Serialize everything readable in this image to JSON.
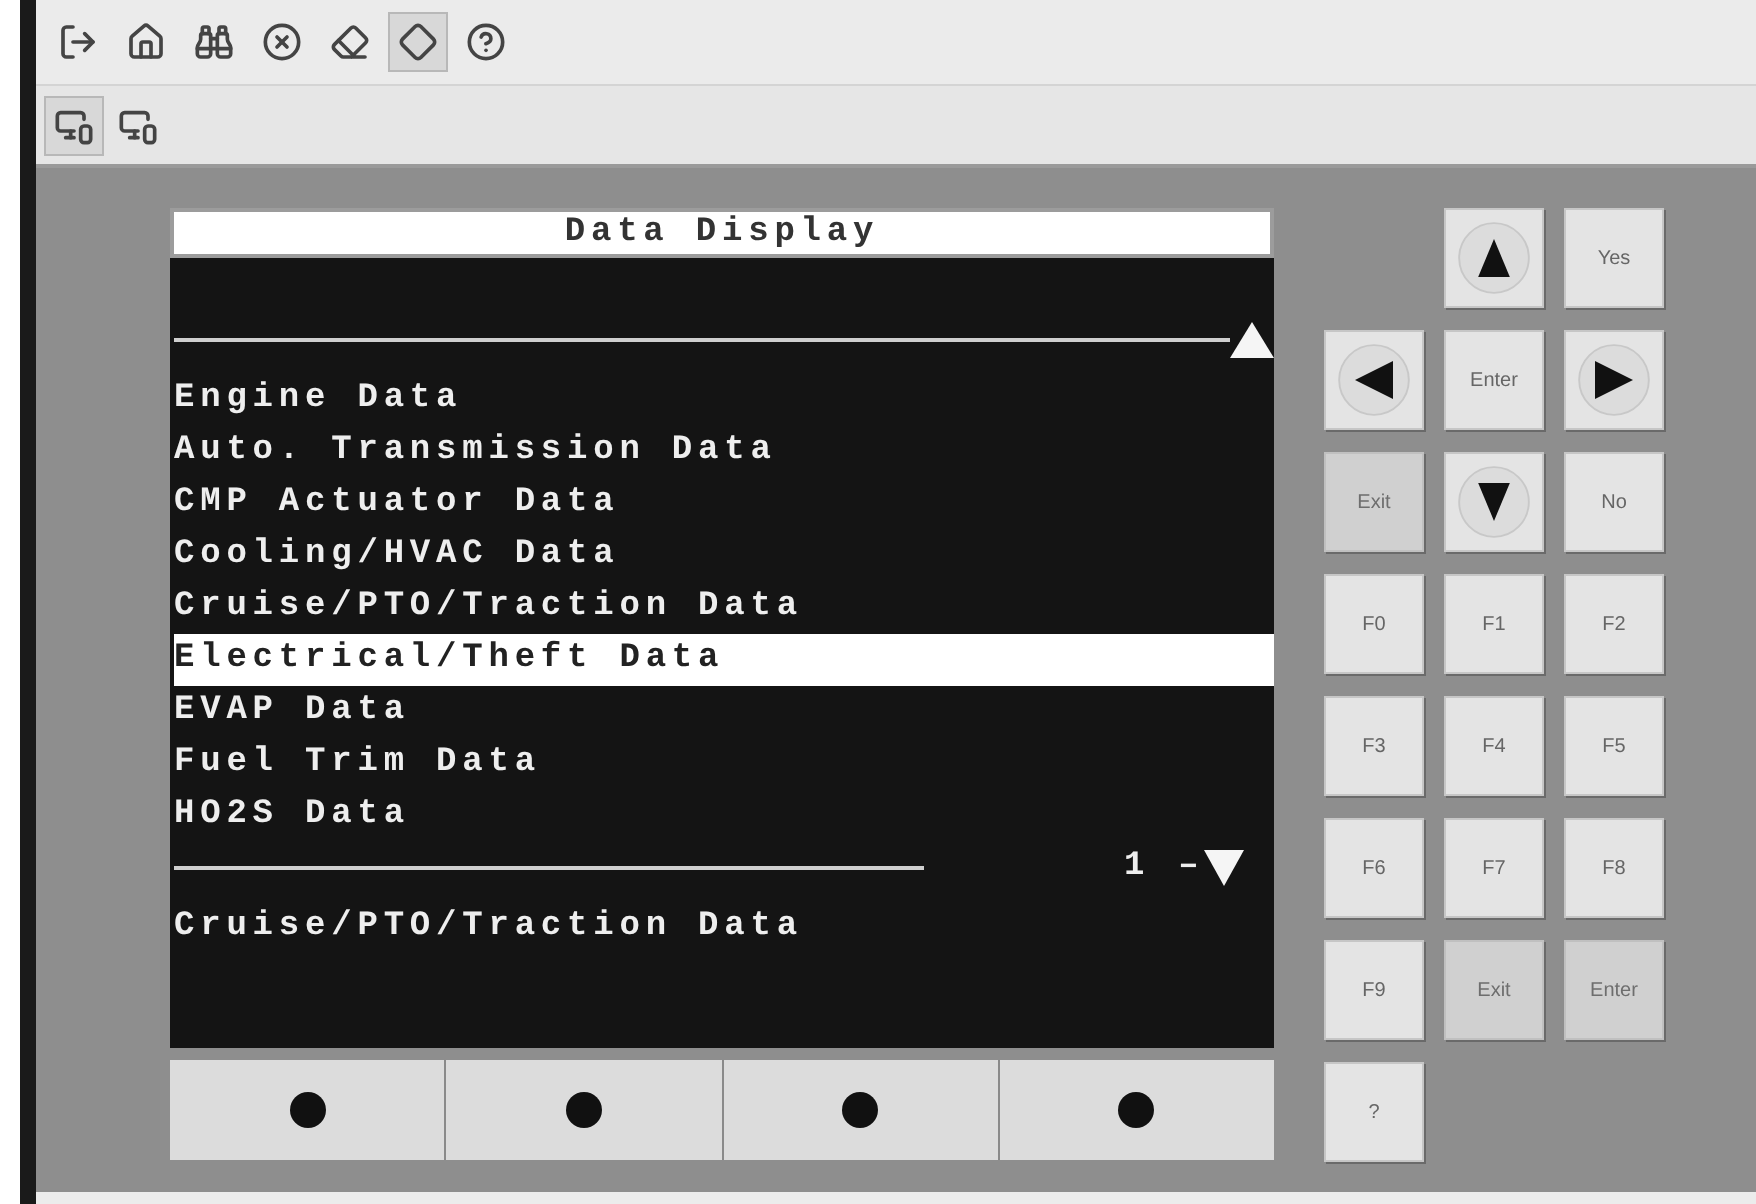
{
  "toolbar": [
    {
      "kind": "exit",
      "selected": false
    },
    {
      "kind": "home",
      "selected": false
    },
    {
      "kind": "binoculars",
      "selected": false
    },
    {
      "kind": "stop",
      "selected": false
    },
    {
      "kind": "eraser",
      "selected": false
    },
    {
      "kind": "diamond",
      "selected": true
    },
    {
      "kind": "help",
      "selected": false
    }
  ],
  "device_toolbar": [
    {
      "kind": "device",
      "selected": true
    },
    {
      "kind": "device",
      "selected": false
    }
  ],
  "screen": {
    "title": "Data Display",
    "items": [
      {
        "label": "Engine Data",
        "selected": false
      },
      {
        "label": "Auto. Transmission Data",
        "selected": false
      },
      {
        "label": "CMP Actuator Data",
        "selected": false
      },
      {
        "label": "Cooling/HVAC Data",
        "selected": false
      },
      {
        "label": "Cruise/PTO/Traction Data",
        "selected": false
      },
      {
        "label": "Electrical/Theft Data",
        "selected": true
      },
      {
        "label": "EVAP Data",
        "selected": false
      },
      {
        "label": "Fuel Trim Data",
        "selected": false
      },
      {
        "label": "HO2S Data",
        "selected": false
      }
    ],
    "page": "1",
    "page_dash": "–",
    "footer": "Cruise/PTO/Traction Data"
  },
  "soft_keys": [
    {
      "kind": "dot"
    },
    {
      "kind": "dot"
    },
    {
      "kind": "dot"
    },
    {
      "kind": "dot"
    }
  ],
  "keypad": [
    {
      "kind": "blank"
    },
    {
      "kind": "arrow_up"
    },
    {
      "kind": "key",
      "label": "Yes",
      "disabled": false
    },
    {
      "kind": "arrow_left"
    },
    {
      "kind": "key",
      "label": "Enter",
      "disabled": false
    },
    {
      "kind": "arrow_right"
    },
    {
      "kind": "key",
      "label": "Exit",
      "disabled": true
    },
    {
      "kind": "arrow_down"
    },
    {
      "kind": "key",
      "label": "No",
      "disabled": false
    },
    {
      "kind": "key",
      "label": "F0",
      "disabled": false
    },
    {
      "kind": "key",
      "label": "F1",
      "disabled": false
    },
    {
      "kind": "key",
      "label": "F2",
      "disabled": false
    },
    {
      "kind": "key",
      "label": "F3",
      "disabled": false
    },
    {
      "kind": "key",
      "label": "F4",
      "disabled": false
    },
    {
      "kind": "key",
      "label": "F5",
      "disabled": false
    },
    {
      "kind": "key",
      "label": "F6",
      "disabled": false
    },
    {
      "kind": "key",
      "label": "F7",
      "disabled": false
    },
    {
      "kind": "key",
      "label": "F8",
      "disabled": false
    },
    {
      "kind": "key",
      "label": "F9",
      "disabled": false
    },
    {
      "kind": "key",
      "label": "Exit",
      "disabled": true
    },
    {
      "kind": "key",
      "label": "Enter",
      "disabled": true
    },
    {
      "kind": "key",
      "label": "?",
      "disabled": false
    }
  ]
}
